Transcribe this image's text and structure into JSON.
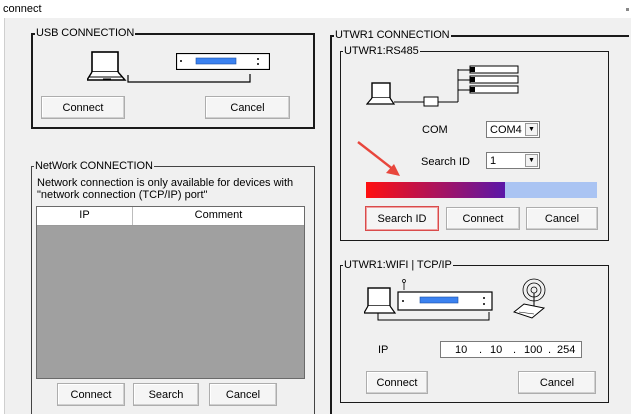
{
  "window": {
    "title": "connect"
  },
  "usb": {
    "legend": "USB CONNECTION",
    "connect_label": "Connect",
    "cancel_label": "Cancel"
  },
  "network": {
    "legend": "NetWork CONNECTION",
    "note": "Network connection is only available for devices with \"network connection (TCP/IP) port\"",
    "columns": [
      "IP",
      "Comment"
    ],
    "connect_label": "Connect",
    "search_label": "Search",
    "cancel_label": "Cancel"
  },
  "utwr1": {
    "legend": "UTWR1 CONNECTION",
    "rs485": {
      "legend": "UTWR1:RS485",
      "com_label": "COM",
      "com_value": "COM4",
      "search_id_label": "Search ID",
      "search_id_value": "1",
      "progress": 0.6,
      "search_id_button": "Search ID",
      "connect_label": "Connect",
      "cancel_label": "Cancel"
    },
    "wifi": {
      "legend": "UTWR1:WIFI  |  TCP/IP",
      "ip_label": "IP",
      "ip": [
        "10",
        "10",
        "100",
        "254"
      ],
      "connect_label": "Connect",
      "cancel_label": "Cancel"
    }
  },
  "colors": {
    "progress_start": "#ff1010",
    "progress_end": "#5a17a8",
    "progress_remaining": "#aac4f3",
    "annotation_arrow": "#e8463c",
    "list_background": "#a0a0a0"
  }
}
